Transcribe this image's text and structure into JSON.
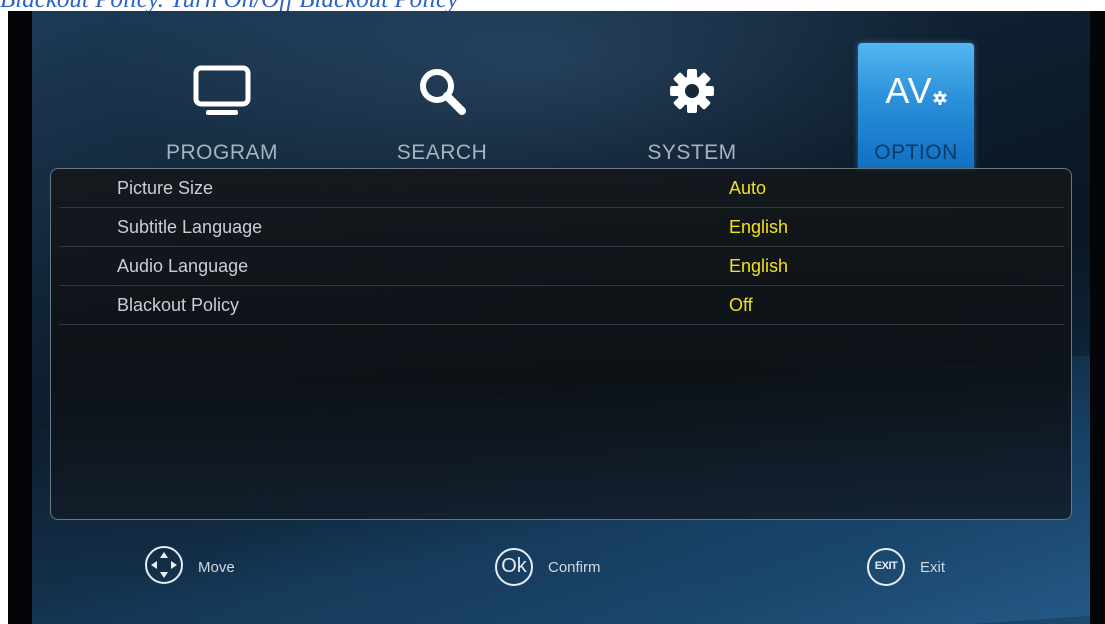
{
  "caption": "Blackout Policy. Turn On/Off Blackout Policy",
  "tabs": [
    {
      "label": "PROGRAM",
      "icon": "monitor-icon",
      "active": false
    },
    {
      "label": "SEARCH",
      "icon": "search-icon",
      "active": false
    },
    {
      "label": "SYSTEM",
      "icon": "gear-icon",
      "active": false
    },
    {
      "label": "OPTION",
      "icon": "av-settings-icon",
      "active": true,
      "icon_text": "AV"
    }
  ],
  "settings": [
    {
      "name": "Picture Size",
      "value": "Auto"
    },
    {
      "name": "Subtitle Language",
      "value": "English"
    },
    {
      "name": "Audio Language",
      "value": "English"
    },
    {
      "name": "Blackout Policy",
      "value": "Off"
    }
  ],
  "hints": [
    {
      "label": "Move",
      "icon": "dpad-icon"
    },
    {
      "label": "Confirm",
      "icon": "ok-icon",
      "icon_text": "Ok"
    },
    {
      "label": "Exit",
      "icon": "exit-icon",
      "icon_text": "EXIT"
    }
  ],
  "colors": {
    "value_text": "#f2e21d",
    "active_tab": "#2a8fd8",
    "label_text": "#c7cfd6"
  }
}
